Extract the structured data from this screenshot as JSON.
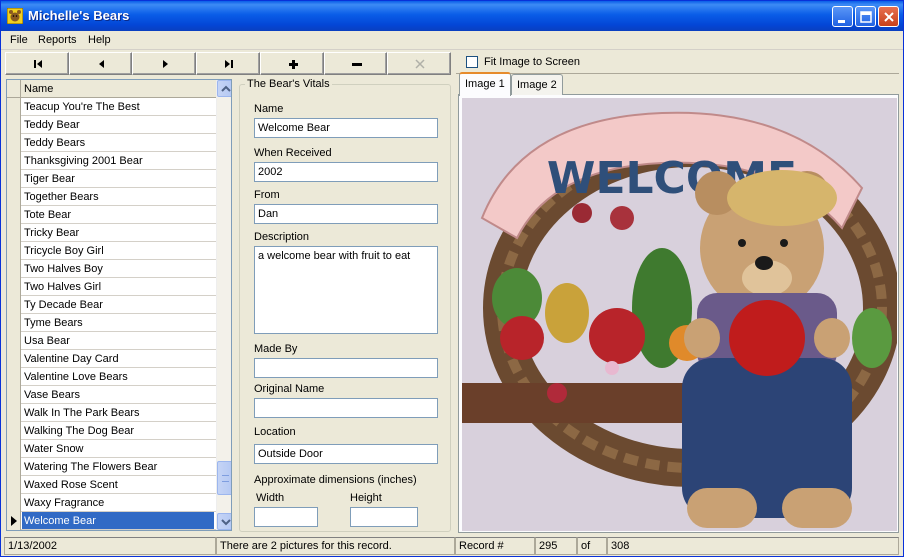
{
  "window": {
    "title": "Michelle's Bears"
  },
  "menu": {
    "items": [
      "File",
      "Reports",
      "Help"
    ]
  },
  "list": {
    "column_header": "Name",
    "items": [
      "Teacup You're The Best",
      "Teddy Bear",
      "Teddy Bears",
      "Thanksgiving 2001 Bear",
      "Tiger Bear",
      "Together Bears",
      "Tote Bear",
      "Tricky Bear",
      "Tricycle Boy Girl",
      "Two Halves Boy",
      "Two Halves Girl",
      "Ty Decade Bear",
      "Tyme Bears",
      "Usa Bear",
      "Valentine Day Card",
      "Valentine Love Bears",
      "Vase Bears",
      "Walk In The Park Bears",
      "Walking The Dog Bear",
      "Water Snow",
      "Watering The Flowers Bear",
      "Waxed Rose Scent",
      "Waxy Fragrance",
      "Welcome Bear"
    ],
    "selected_index": 23
  },
  "vitals": {
    "legend": "The Bear's Vitals",
    "name_label": "Name",
    "name_value": "Welcome Bear",
    "received_label": "When Received",
    "received_value": "2002",
    "from_label": "From",
    "from_value": "Dan",
    "description_label": "Description",
    "description_value": "a welcome bear  with fruit to eat",
    "made_by_label": "Made By",
    "made_by_value": "",
    "original_name_label": "Original Name",
    "original_name_value": "",
    "location_label": "Location",
    "location_value": "Outside Door",
    "dimensions_label": "Approximate dimensions (inches)",
    "width_label": "Width",
    "width_value": "",
    "height_label": "Height",
    "height_value": ""
  },
  "image_pane": {
    "fit_label": "Fit Image to Screen",
    "fit_checked": false,
    "tabs": [
      "Image 1",
      "Image 2"
    ],
    "active_tab": 0,
    "photo_text": "WELCOME"
  },
  "status": {
    "date": "1/13/2002",
    "message": "There are 2 pictures for this record.",
    "record_label": "Record #",
    "record_number": "295",
    "of_label": "of",
    "record_total": "308"
  },
  "colors": {
    "titlebar": "#0a5de8",
    "selection": "#316ac5",
    "tab_highlight": "#e68b2c"
  }
}
